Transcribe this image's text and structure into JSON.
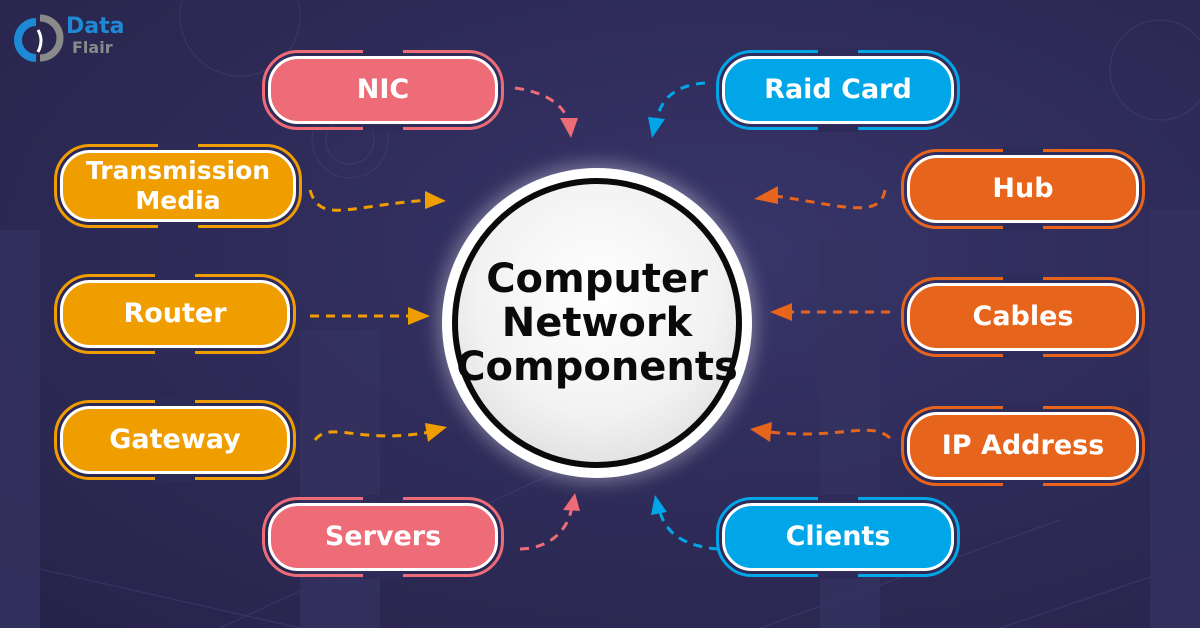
{
  "logo": {
    "line1": "Data",
    "line2": "Flair"
  },
  "center": {
    "title_lines": [
      "Computer",
      "Network",
      "Components"
    ]
  },
  "colors": {
    "pink": "#ee6b78",
    "orange_yellow": "#f09d00",
    "blue": "#00a6e8",
    "orange": "#e7641c",
    "background": "#2e2b58"
  },
  "components": [
    {
      "id": "nic",
      "label": "NIC",
      "color": "#ee6b78",
      "side": "left"
    },
    {
      "id": "transmission-media",
      "label": "Transmission Media",
      "color": "#f09d00",
      "side": "left"
    },
    {
      "id": "router",
      "label": "Router",
      "color": "#f09d00",
      "side": "left"
    },
    {
      "id": "gateway",
      "label": "Gateway",
      "color": "#f09d00",
      "side": "left"
    },
    {
      "id": "servers",
      "label": "Servers",
      "color": "#ee6b78",
      "side": "left"
    },
    {
      "id": "raid-card",
      "label": "Raid Card",
      "color": "#00a6e8",
      "side": "right"
    },
    {
      "id": "hub",
      "label": "Hub",
      "color": "#e7641c",
      "side": "right"
    },
    {
      "id": "cables",
      "label": "Cables",
      "color": "#e7641c",
      "side": "right"
    },
    {
      "id": "ip-address",
      "label": "IP Address",
      "color": "#e7641c",
      "side": "right"
    },
    {
      "id": "clients",
      "label": "Clients",
      "color": "#00a6e8",
      "side": "right"
    }
  ]
}
